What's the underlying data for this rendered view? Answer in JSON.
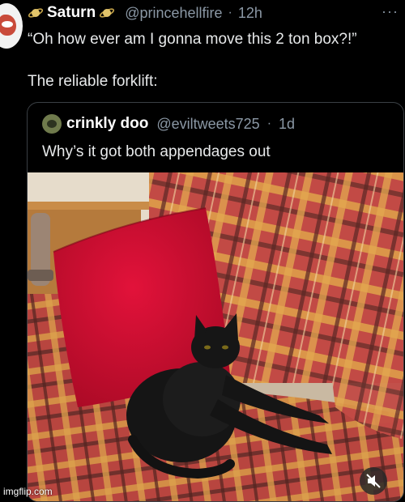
{
  "tweet": {
    "author": "Saturn",
    "handle": "@princehellfire",
    "separator": "·",
    "time": "12h",
    "text": "“Oh how ever am I gonna move this 2 ton box?!”",
    "caption": "The reliable forklift:"
  },
  "quoted_tweet": {
    "author": "crinkly doo",
    "handle": "@eviltweets725",
    "separator": "·",
    "time": "1d",
    "text": "Why’s it got both appendages out"
  },
  "watermark": "imgflip.com",
  "icons": {
    "author_badges": "saturn-icon",
    "more": "more-options-icon",
    "media": "mute-icon"
  },
  "colors": {
    "background": "#000000",
    "text": "#e7e9ea",
    "secondary": "#8b98a5"
  }
}
